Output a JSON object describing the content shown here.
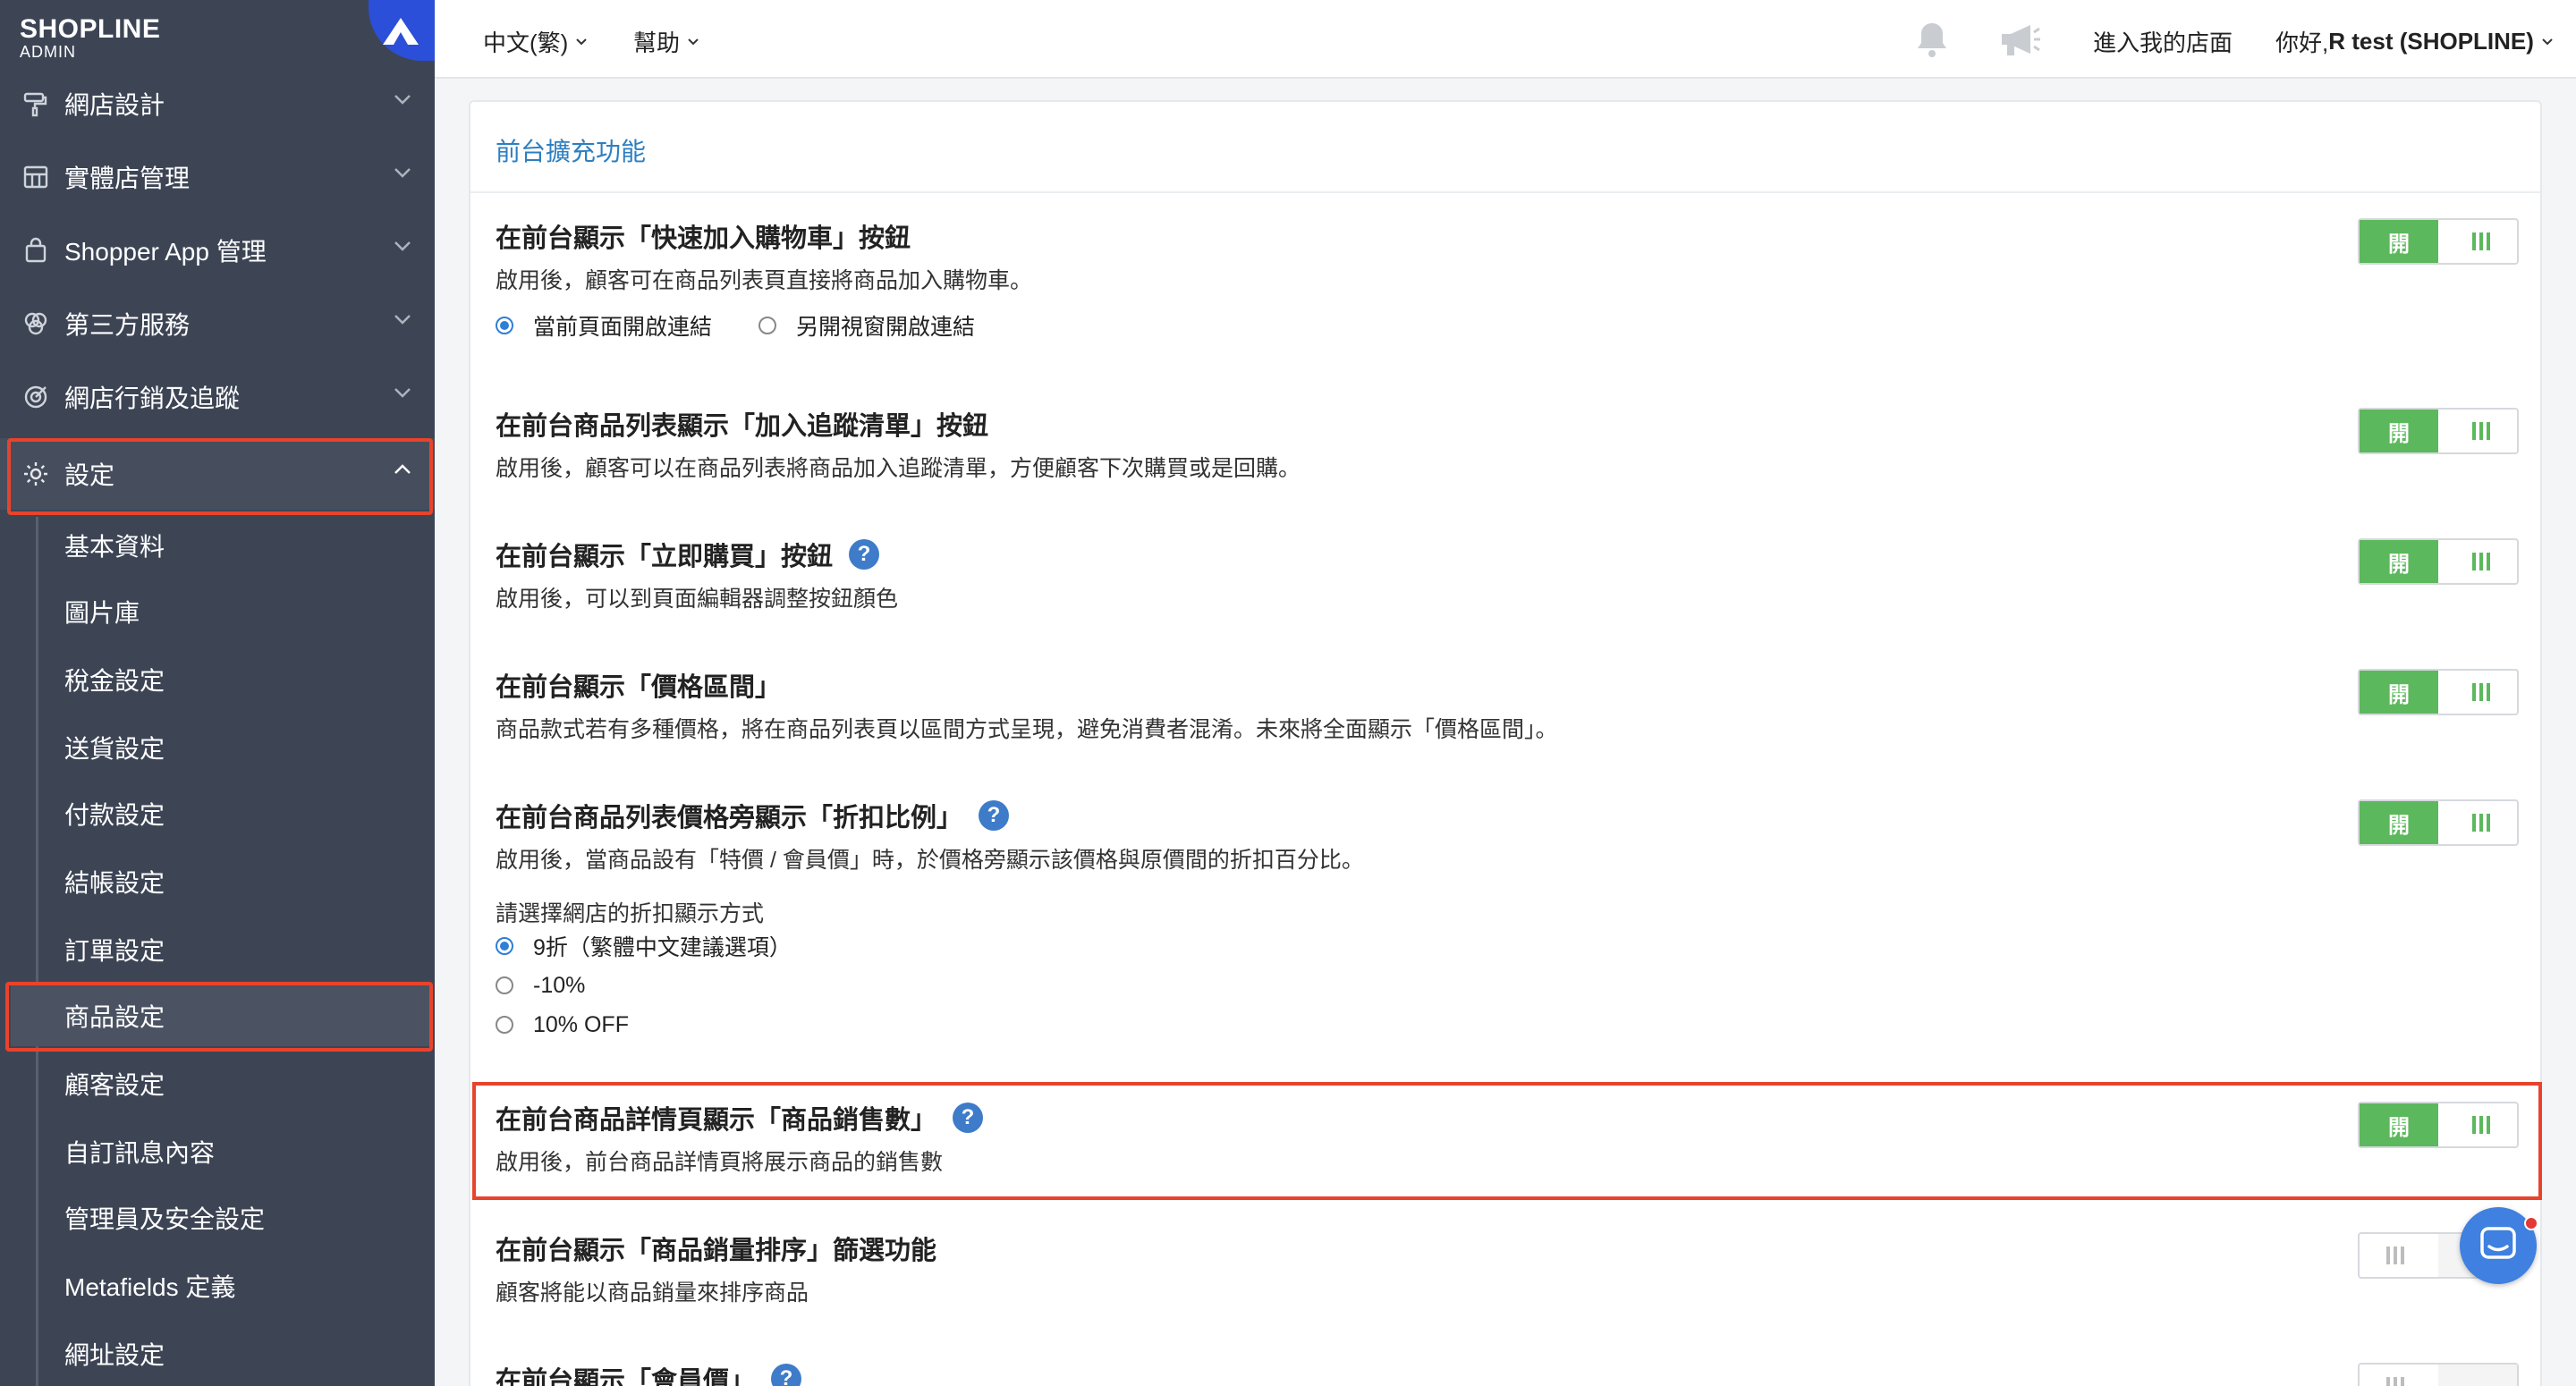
{
  "brand": {
    "name": "SHOPLINE",
    "sub": "ADMIN"
  },
  "sidebar": {
    "items": [
      {
        "label": "網店設計",
        "icon": "paint-roller-icon"
      },
      {
        "label": "實體店管理",
        "icon": "store-icon"
      },
      {
        "label": "Shopper App 管理",
        "icon": "shopping-bag-icon"
      },
      {
        "label": "第三方服務",
        "icon": "apps-icon"
      },
      {
        "label": "網店行銷及追蹤",
        "icon": "target-icon"
      },
      {
        "label": "設定",
        "icon": "gear-icon"
      }
    ],
    "sub_items": [
      {
        "label": "基本資料"
      },
      {
        "label": "圖片庫"
      },
      {
        "label": "稅金設定"
      },
      {
        "label": "送貨設定"
      },
      {
        "label": "付款設定"
      },
      {
        "label": "結帳設定"
      },
      {
        "label": "訂單設定"
      },
      {
        "label": "商品設定"
      },
      {
        "label": "顧客設定"
      },
      {
        "label": "自訂訊息內容"
      },
      {
        "label": "管理員及安全設定"
      },
      {
        "label": "Metafields 定義"
      },
      {
        "label": "網址設定"
      }
    ]
  },
  "topbar": {
    "language": "中文(繁)",
    "help": "幫助",
    "visit_store": "進入我的店面",
    "greeting_prefix": "你好, ",
    "user": "R test (SHOPLINE)"
  },
  "panel": {
    "title": "前台擴充功能",
    "toggle_on_label": "開",
    "settings": [
      {
        "title": "在前台顯示「快速加入購物車」按鈕",
        "desc": "啟用後，顧客可在商品列表頁直接將商品加入購物車。",
        "radios": [
          "當前頁面開啟連結",
          "另開視窗開啟連結"
        ],
        "enabled": true
      },
      {
        "title": "在前台商品列表顯示「加入追蹤清單」按鈕",
        "desc": "啟用後，顧客可以在商品列表將商品加入追蹤清單，方便顧客下次購買或是回購。",
        "enabled": true
      },
      {
        "title": "在前台顯示「立即購買」按鈕",
        "desc": "啟用後，可以到頁面編輯器調整按鈕顏色",
        "enabled": true
      },
      {
        "title": "在前台顯示「價格區間」",
        "desc": "商品款式若有多種價格，將在商品列表頁以區間方式呈現，避免消費者混淆。未來將全面顯示「價格區間」。",
        "enabled": true
      },
      {
        "title": "在前台商品列表價格旁顯示「折扣比例」",
        "desc": "啟用後，當商品設有「特價 / 會員價」時，於價格旁顯示該價格與原價間的折扣百分比。",
        "subheading": "請選擇網店的折扣顯示方式",
        "radios": [
          "9折（繁體中文建議選項）",
          "-10%",
          "10% OFF"
        ],
        "enabled": true
      },
      {
        "title": "在前台商品詳情頁顯示「商品銷售數」",
        "desc": "啟用後，前台商品詳情頁將展示商品的銷售數",
        "enabled": true
      },
      {
        "title": "在前台顯示「商品銷量排序」篩選功能",
        "desc": "顧客將能以商品銷量來排序商品",
        "enabled": false
      },
      {
        "title": "在前台顯示「會員價」",
        "enabled": false
      }
    ]
  },
  "colors": {
    "sidebar_bg": "#3d4555",
    "accent_blue": "#2d7fc1",
    "toggle_green": "#5cb85c",
    "highlight_red": "#e8432c"
  }
}
